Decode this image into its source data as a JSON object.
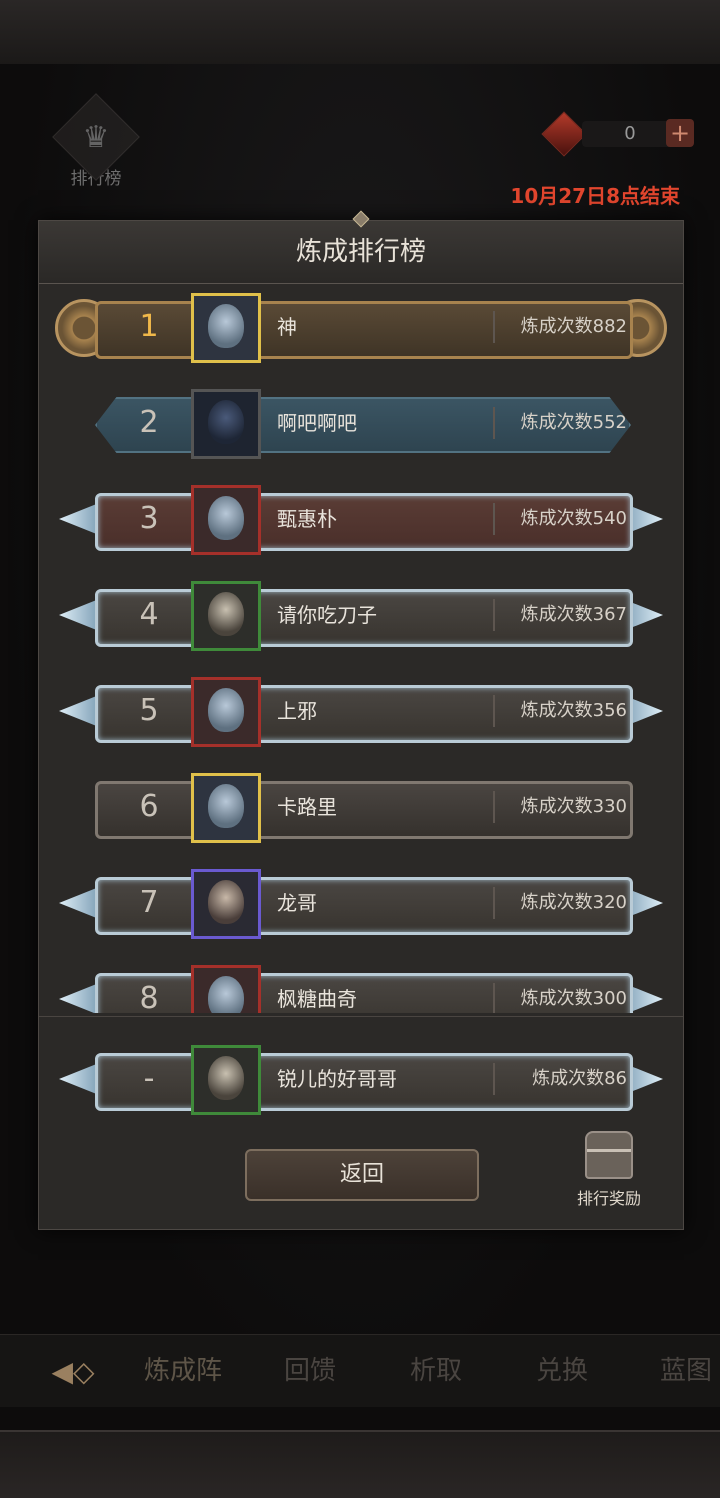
{
  "top": {
    "rank_entry_label": "排行榜",
    "currency_value": "0",
    "end_time": "10月27日8点结束"
  },
  "panel": {
    "title": "炼成排行榜",
    "rows": [
      {
        "rank": "1",
        "name": "神",
        "score": "炼成次数882"
      },
      {
        "rank": "2",
        "name": "啊吧啊吧",
        "score": "炼成次数552"
      },
      {
        "rank": "3",
        "name": "甄惠朴",
        "score": "炼成次数540"
      },
      {
        "rank": "4",
        "name": "请你吃刀子",
        "score": "炼成次数367"
      },
      {
        "rank": "5",
        "name": "上邪",
        "score": "炼成次数356"
      },
      {
        "rank": "6",
        "name": "卡路里",
        "score": "炼成次数330"
      },
      {
        "rank": "7",
        "name": "龙哥",
        "score": "炼成次数320"
      },
      {
        "rank": "8",
        "name": "枫糖曲奇",
        "score": "炼成次数300"
      }
    ],
    "my_row": {
      "rank": "-",
      "name": "锐儿的好哥哥",
      "score": "炼成次数86"
    },
    "return_label": "返回",
    "reward_label": "排行奖励"
  },
  "tabs": [
    "炼成阵",
    "回馈",
    "析取",
    "兑换",
    "蓝图"
  ],
  "colors": {
    "accent_red": "#e2462e",
    "gold": "#f0b84a"
  }
}
